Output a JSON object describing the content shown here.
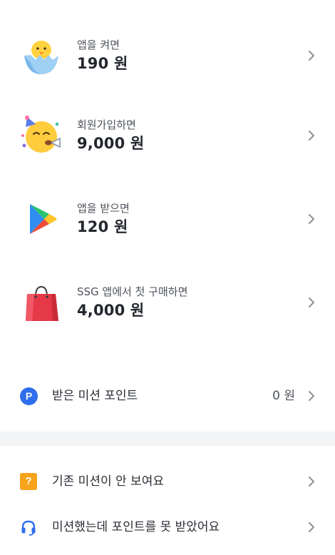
{
  "rewards": [
    {
      "caption": "앱을 켜면",
      "amount": "190 원",
      "icon": "hatching-chick-icon"
    },
    {
      "caption": "회원가입하면",
      "amount": "9,000 원",
      "icon": "party-face-icon"
    },
    {
      "caption": "앱을 받으면",
      "amount": "120 원",
      "icon": "play-store-icon"
    },
    {
      "caption": "SSG 앱에서 첫 구매하면",
      "amount": "4,000 원",
      "icon": "shopping-bag-icon"
    }
  ],
  "mission_points": {
    "badge": "P",
    "label": "받은 미션 포인트",
    "value": "0 원"
  },
  "help": [
    {
      "label": "기존 미션이 안 보여요",
      "icon": "question-icon",
      "icon_text": "?"
    },
    {
      "label": "미션했는데 포인트를 못 받았어요",
      "icon": "headset-icon"
    }
  ],
  "colors": {
    "accent_blue": "#2f6fed",
    "question_orange": "#f7a31c",
    "divider_gray": "#f2f3f5",
    "chevron_gray": "#8b9099"
  }
}
